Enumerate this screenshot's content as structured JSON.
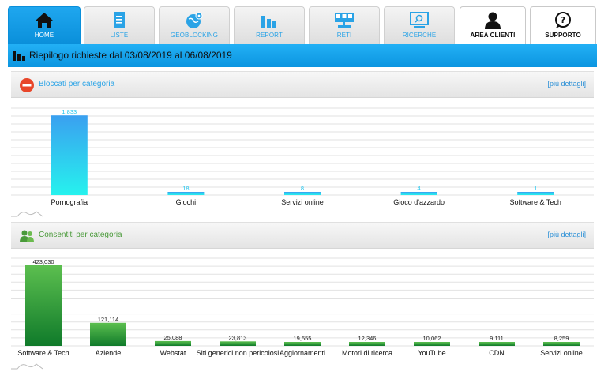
{
  "nav": {
    "tabs": [
      {
        "label": "HOME",
        "icon": "home-icon",
        "active": true
      },
      {
        "label": "LISTE",
        "icon": "document-icon"
      },
      {
        "label": "GEOBLOCKING",
        "icon": "globe-pin-icon"
      },
      {
        "label": "REPORT",
        "icon": "bar-chart-icon"
      },
      {
        "label": "RETI",
        "icon": "network-icon"
      },
      {
        "label": "RICERCHE",
        "icon": "search-monitor-icon"
      },
      {
        "label": "AREA CLIENTI",
        "icon": "user-icon"
      },
      {
        "label": "SUPPORTO",
        "icon": "support-chat-icon"
      }
    ]
  },
  "summary": {
    "text": "Riepilogo richieste dal 03/08/2019 al 06/08/2019"
  },
  "blocked": {
    "title": "Bloccati per categoria",
    "more": "[più dettagli]"
  },
  "allowed": {
    "title": "Consentiti per categoria",
    "more": "[più dettagli]"
  },
  "colors": {
    "accent": "#0c95e0",
    "blocked_bar_top": "#3aa0f0",
    "blocked_bar_bottom": "#26f2ee",
    "allowed_bar_top": "#5cbf4f",
    "allowed_bar_bottom": "#0f7a2a"
  },
  "chart_data": [
    {
      "type": "bar",
      "categories": [
        "Pornografia",
        "Giochi",
        "Servizi online",
        "Gioco d'azzardo",
        "Software & Tech"
      ],
      "values": [
        1833,
        18,
        8,
        4,
        1
      ],
      "value_labels": [
        "1,833",
        "18",
        "8",
        "4",
        "1"
      ],
      "ylim": [
        0,
        2000
      ],
      "grid": true
    },
    {
      "type": "bar",
      "categories": [
        "Software & Tech",
        "Aziende",
        "Webstat",
        "Siti generici non pericolosi",
        "Aggiornamenti",
        "Motori di ricerca",
        "YouTube",
        "CDN",
        "Servizi online"
      ],
      "values": [
        423030,
        121114,
        25088,
        23813,
        19555,
        12346,
        10062,
        9111,
        8259
      ],
      "value_labels": [
        "423,030",
        "121,114",
        "25,088",
        "23,813",
        "19,555",
        "12,346",
        "10,062",
        "9,111",
        "8,259"
      ],
      "ylim": [
        0,
        460000
      ],
      "grid": true
    }
  ]
}
